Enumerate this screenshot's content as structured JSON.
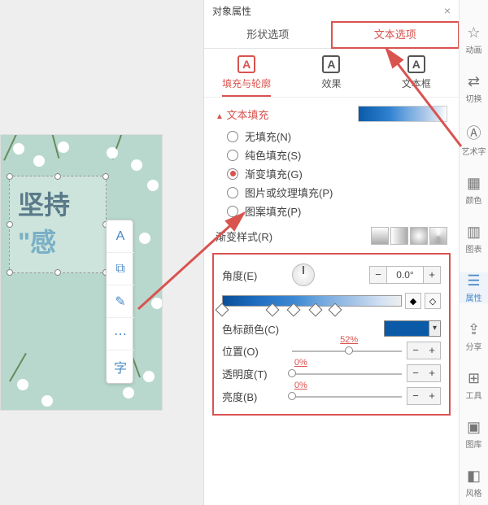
{
  "panel": {
    "title": "对象属性",
    "main_tabs": {
      "shape": "形状选项",
      "text": "文本选项"
    },
    "sub_tabs": {
      "fill": "填充与轮廓",
      "effect": "效果",
      "textbox": "文本框"
    }
  },
  "text_fill": {
    "header": "文本填充",
    "options": {
      "none": "无填充(N)",
      "solid": "纯色填充(S)",
      "gradient": "渐变填充(G)",
      "picture": "图片或纹理填充(P)",
      "pattern": "图案填充(P)"
    },
    "selected": "gradient"
  },
  "gradient": {
    "style_label": "渐变样式(R)",
    "angle_label": "角度(E)",
    "angle_value": "0.0°",
    "stops": [
      0,
      28,
      40,
      52,
      63
    ],
    "stop_color_label": "色标颜色(C)",
    "stop_color": "#0a5aa8",
    "position_label": "位置(O)",
    "position_value": "52%",
    "position_pct": 52,
    "opacity_label": "透明度(T)",
    "opacity_value": "0%",
    "opacity_pct": 0,
    "brightness_label": "亮度(B)",
    "brightness_value": "0%",
    "brightness_pct": 0
  },
  "slide_text": {
    "line1": "坚持",
    "line2": "\"感"
  },
  "rail": {
    "anim": "动画",
    "trans": "切换",
    "art": "艺术字",
    "color": "颜色",
    "chart": "图表",
    "prop": "属性",
    "share": "分享",
    "tool": "工具",
    "library": "图库",
    "style": "风格"
  },
  "stepper": {
    "minus": "−",
    "plus": "+"
  },
  "mini_tb": {
    "text": "A",
    "layer": "⧉",
    "brush": "✎",
    "more": "⋯",
    "font": "字"
  }
}
